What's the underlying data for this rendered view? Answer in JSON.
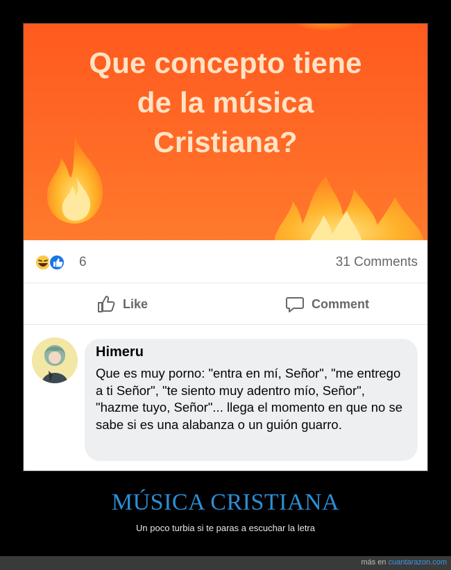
{
  "post": {
    "image_text_lines": [
      "Que concepto tiene",
      "de la música",
      "Cristiana?"
    ],
    "reaction_count": "6",
    "comments_count": "31 Comments",
    "actions": {
      "like_label": "Like",
      "comment_label": "Comment"
    }
  },
  "comment": {
    "author": "Himeru",
    "text": "Que es muy porno: \"entra en mí, Señor\", \"me entrego a ti Señor\", \"te siento muy adentro mío, Señor\", \"hazme tuyo, Señor\"... llega el momento en que no se sabe si es una alabanza o un guión guarro."
  },
  "caption": {
    "title": "MÚSICA CRISTIANA",
    "subtitle": "Un poco turbia si te paras a escuchar la letra"
  },
  "footer": {
    "prefix": "más en ",
    "link_text": "cuantarazon.com"
  },
  "colors": {
    "image_background": "#ff5a1e",
    "headline_text": "#ffe3c6",
    "caption_title": "#2b8fd6",
    "link": "#3a98e2"
  },
  "icons": [
    "haha-reaction-icon",
    "like-reaction-icon",
    "thumbs-up-icon",
    "comment-icon",
    "flame-icon"
  ]
}
